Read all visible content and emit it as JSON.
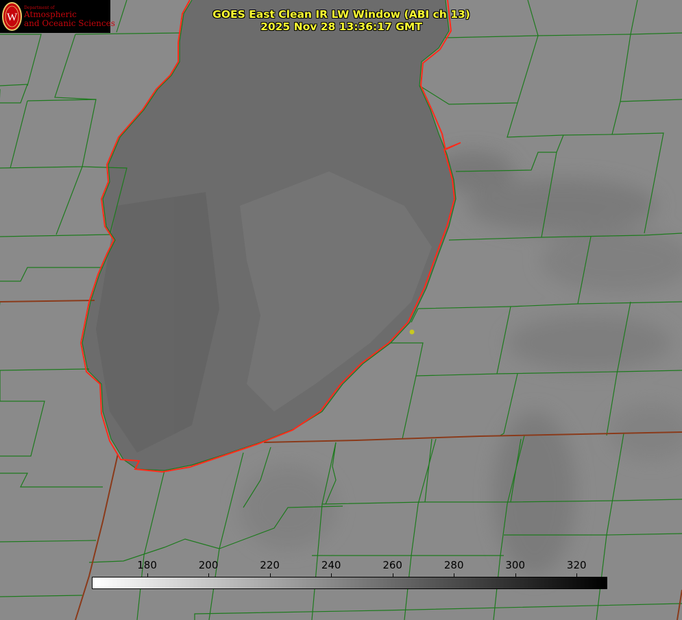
{
  "header": {
    "logo": {
      "dept_label": "Department of",
      "line1": "Atmospheric",
      "line2": "and Oceanic Sciences",
      "seal_letter": "W",
      "color": "#c5050c"
    },
    "title_line1": "GOES East Clean IR LW Window (ABI ch 13)",
    "title_line2": "2025 Nov 28 13:36:17 GMT",
    "title_color": "#ffff33"
  },
  "colorbar": {
    "ticks": [
      "180",
      "200",
      "220",
      "240",
      "260",
      "280",
      "300",
      "320"
    ],
    "tick_values": [
      180,
      200,
      220,
      240,
      260,
      280,
      300,
      320
    ],
    "range": [
      162,
      330
    ],
    "gradient_from": "#ffffff",
    "gradient_to": "#000000"
  },
  "map": {
    "colors": {
      "land": "#8a8a8a",
      "lake": "#6b6b6b",
      "county_border": "#1d7a1d",
      "coastline": "#ff2a1a",
      "state_border": "#8a3a1a",
      "marker": "#c8c820"
    },
    "marker_icon": "location-dot-icon"
  }
}
